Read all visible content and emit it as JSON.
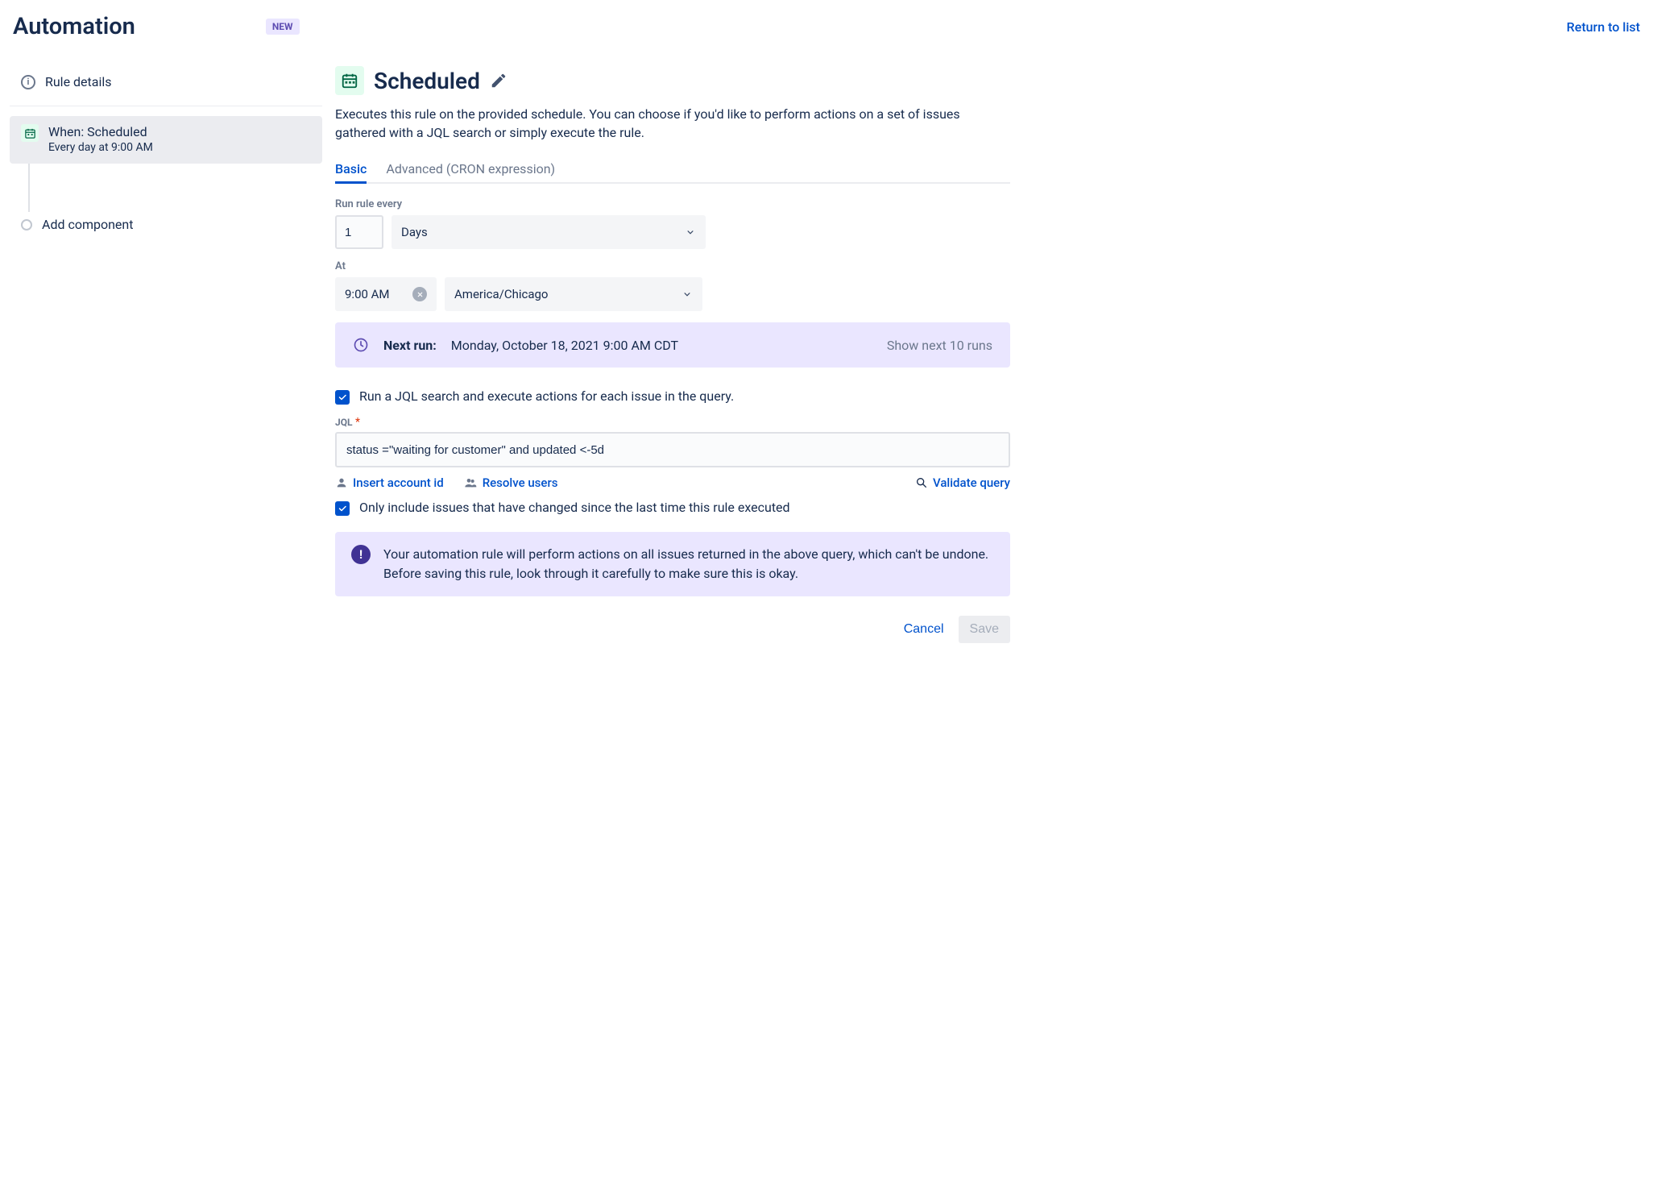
{
  "header": {
    "title": "Automation",
    "badge": "NEW",
    "return_label": "Return to list"
  },
  "sidebar": {
    "rule_details_label": "Rule details",
    "scheduled_card": {
      "title": "When: Scheduled",
      "subtitle": "Every day at 9:00 AM"
    },
    "add_component_label": "Add component"
  },
  "main": {
    "title": "Scheduled",
    "description": "Executes this rule on the provided schedule. You can choose if you'd like to perform actions on a set of issues gathered with a JQL search or simply execute the rule.",
    "tabs": {
      "basic": "Basic",
      "advanced": "Advanced (CRON expression)"
    },
    "run_every": {
      "label": "Run rule every",
      "value": "1",
      "unit": "Days"
    },
    "at": {
      "label": "At",
      "time": "9:00 AM",
      "timezone": "America/Chicago"
    },
    "next_run": {
      "label": "Next run:",
      "value": "Monday, October 18, 2021 9:00 AM CDT",
      "show_more": "Show next 10 runs"
    },
    "jql_check_label": "Run a JQL search and execute actions for each issue in the query.",
    "jql": {
      "label": "JQL",
      "value": "status =\"waiting for customer\" and updated <-5d"
    },
    "actions": {
      "insert_account": "Insert account id",
      "resolve_users": "Resolve users",
      "validate": "Validate query"
    },
    "only_changed_label": "Only include issues that have changed since the last time this rule executed",
    "warning": "Your automation rule will perform actions on all issues returned in the above query, which can't be undone. Before saving this rule, look through it carefully to make sure this is okay.",
    "footer": {
      "cancel": "Cancel",
      "save": "Save"
    }
  }
}
